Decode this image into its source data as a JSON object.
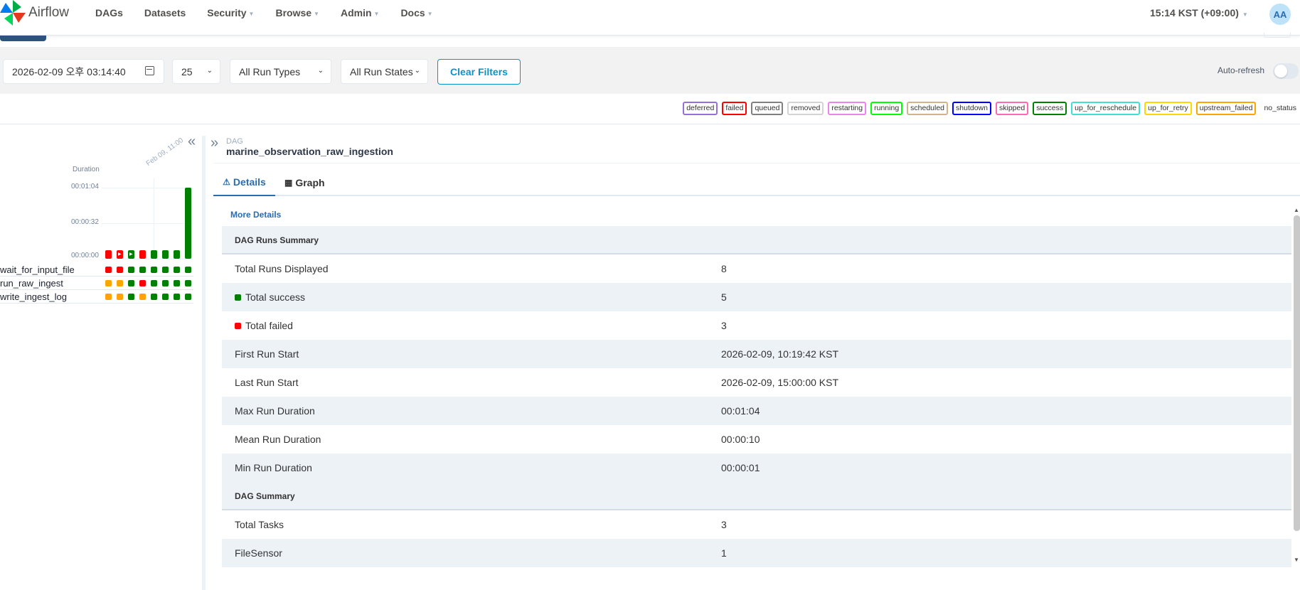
{
  "navbar": {
    "brand": "Airflow",
    "links": [
      {
        "label": "DAGs",
        "dropdown": false
      },
      {
        "label": "Datasets",
        "dropdown": false
      },
      {
        "label": "Security",
        "dropdown": true
      },
      {
        "label": "Browse",
        "dropdown": true
      },
      {
        "label": "Admin",
        "dropdown": true
      },
      {
        "label": "Docs",
        "dropdown": true
      }
    ],
    "time": "15:14 KST (+09:00)",
    "avatar": "AA"
  },
  "filters": {
    "base_date": "2026-02-09 오후 03:14:40",
    "num_runs": "25",
    "run_type": "All Run Types",
    "run_state": "All Run States",
    "clear_label": "Clear Filters",
    "auto_refresh_label": "Auto-refresh",
    "auto_refresh_on": false
  },
  "legend": [
    {
      "label": "deferred",
      "color": "#9370db"
    },
    {
      "label": "failed",
      "color": "#ff0000"
    },
    {
      "label": "queued",
      "color": "#808080"
    },
    {
      "label": "removed",
      "color": "#d3d3d3"
    },
    {
      "label": "restarting",
      "color": "#ee82ee"
    },
    {
      "label": "running",
      "color": "#00ff00"
    },
    {
      "label": "scheduled",
      "color": "#d2b48c"
    },
    {
      "label": "shutdown",
      "color": "#0000ff"
    },
    {
      "label": "skipped",
      "color": "#ff69b4"
    },
    {
      "label": "success",
      "color": "#008000"
    },
    {
      "label": "up_for_reschedule",
      "color": "#40e0d0"
    },
    {
      "label": "up_for_retry",
      "color": "#ffd700"
    },
    {
      "label": "upstream_failed",
      "color": "#ffa500"
    },
    {
      "label": "no_status",
      "color": "transparent"
    }
  ],
  "grid": {
    "duration_label": "Duration",
    "y_ticks": [
      "00:01:04",
      "00:00:32",
      "00:00:00"
    ],
    "date_label": "Feb 09, 11:00",
    "runs": [
      {
        "state": "failed",
        "duration_s": 1,
        "color": "#ff0000",
        "play": false
      },
      {
        "state": "failed",
        "duration_s": 1,
        "color": "#ff0000",
        "play": true
      },
      {
        "state": "success",
        "duration_s": 1,
        "color": "#008000",
        "play": true
      },
      {
        "state": "failed",
        "duration_s": 1,
        "color": "#ff0000",
        "play": false
      },
      {
        "state": "success",
        "duration_s": 1,
        "color": "#008000",
        "play": false
      },
      {
        "state": "success",
        "duration_s": 1,
        "color": "#008000",
        "play": false
      },
      {
        "state": "success",
        "duration_s": 1,
        "color": "#008000",
        "play": false
      },
      {
        "state": "success",
        "duration_s": 64,
        "color": "#008000",
        "play": false
      }
    ],
    "tasks": [
      {
        "name": "wait_for_input_file",
        "states": [
          "#ff0000",
          "#ff0000",
          "#008000",
          "#008000",
          "#008000",
          "#008000",
          "#008000",
          "#008000"
        ]
      },
      {
        "name": "run_raw_ingest",
        "states": [
          "#ffa500",
          "#ffa500",
          "#008000",
          "#ff0000",
          "#008000",
          "#008000",
          "#008000",
          "#008000"
        ]
      },
      {
        "name": "write_ingest_log",
        "states": [
          "#ffa500",
          "#ffa500",
          "#008000",
          "#ffa500",
          "#008000",
          "#008000",
          "#008000",
          "#008000"
        ]
      }
    ]
  },
  "details": {
    "dag_label": "DAG",
    "dag_id": "marine_observation_raw_ingestion",
    "tabs": {
      "details": "Details",
      "graph": "Graph"
    },
    "more_details": "More Details",
    "rows": [
      {
        "type": "section",
        "key": "DAG Runs Summary",
        "value": ""
      },
      {
        "type": "row",
        "key": "Total Runs Displayed",
        "value": "8"
      },
      {
        "type": "row",
        "key": "Total success",
        "value": "5",
        "swatch": "#008000"
      },
      {
        "type": "row",
        "key": "Total failed",
        "value": "3",
        "swatch": "#ff0000"
      },
      {
        "type": "row",
        "key": "First Run Start",
        "value": "2026-02-09, 10:19:42 KST"
      },
      {
        "type": "row",
        "key": "Last Run Start",
        "value": "2026-02-09, 15:00:00 KST"
      },
      {
        "type": "row",
        "key": "Max Run Duration",
        "value": "00:01:04"
      },
      {
        "type": "row",
        "key": "Mean Run Duration",
        "value": "00:00:10"
      },
      {
        "type": "row",
        "key": "Min Run Duration",
        "value": "00:00:01"
      },
      {
        "type": "section",
        "key": "DAG Summary",
        "value": ""
      },
      {
        "type": "row",
        "key": "Total Tasks",
        "value": "3"
      },
      {
        "type": "row",
        "key": "FileSensor",
        "value": "1"
      }
    ]
  }
}
